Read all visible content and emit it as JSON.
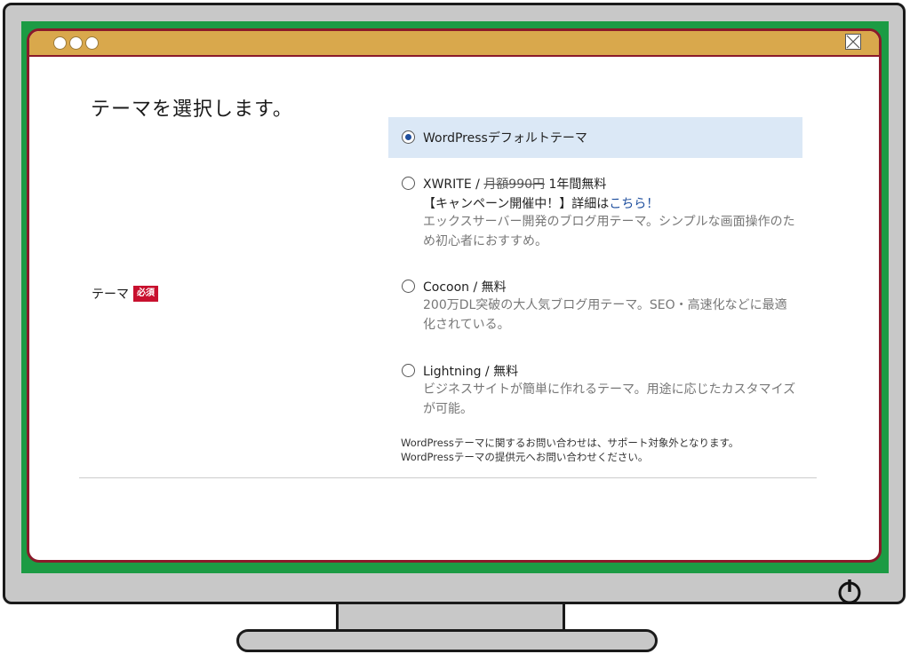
{
  "page": {
    "heading": "テーマを選択します。",
    "field_label": "テーマ",
    "required_badge": "必須"
  },
  "themes": [
    {
      "title": "WordPressデフォルトテーマ",
      "selected": true
    },
    {
      "title": "XWRITE / ",
      "price_struck": "月額990円",
      "price_note": " 1年間無料",
      "campaign_prefix": "【キャンペーン開催中！】詳細は",
      "campaign_link": "こちら！",
      "description": "エックスサーバー開発のブログ用テーマ。シンプルな画面操作のため初心者におすすめ。",
      "selected": false
    },
    {
      "title": "Cocoon / 無料",
      "description": "200万DL突破の大人気ブログ用テーマ。SEO・高速化などに最適化されている。",
      "selected": false
    },
    {
      "title": "Lightning / 無料",
      "description": "ビジネスサイトが簡単に作れるテーマ。用途に応じたカスタマイズが可能。",
      "selected": false
    }
  ],
  "note": {
    "line1": "WordPressテーマに関するお問い合わせは、サポート対象外となります。",
    "line2": "WordPressテーマの提供元へお問い合わせください。"
  },
  "colors": {
    "bezel": "#1c9b44",
    "titlebar": "#d9a84c",
    "window_border": "#8a1a2a",
    "selected_bg": "#dbe8f6",
    "badge": "#c8102e",
    "radio_on": "#1f4f9e"
  },
  "icons": {
    "window_dots": "traffic-light-dots",
    "close": "close-icon",
    "power": "power-icon"
  }
}
